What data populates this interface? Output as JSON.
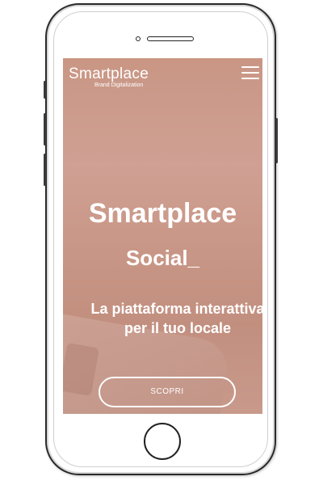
{
  "header": {
    "brand_name": "Smartplace",
    "brand_tagline": "Brand Digitalization",
    "menu_icon": "hamburger-menu-icon"
  },
  "hero": {
    "title": "Smartplace",
    "subtitle": "Social_",
    "description_line1": "La piattaforma interattiva",
    "description_line2": "per il tuo locale",
    "cta_label": "SCOPRI"
  },
  "colors": {
    "screen_background": "#c99684",
    "text": "#ffffff",
    "device_frame": "#2a2a2a"
  }
}
